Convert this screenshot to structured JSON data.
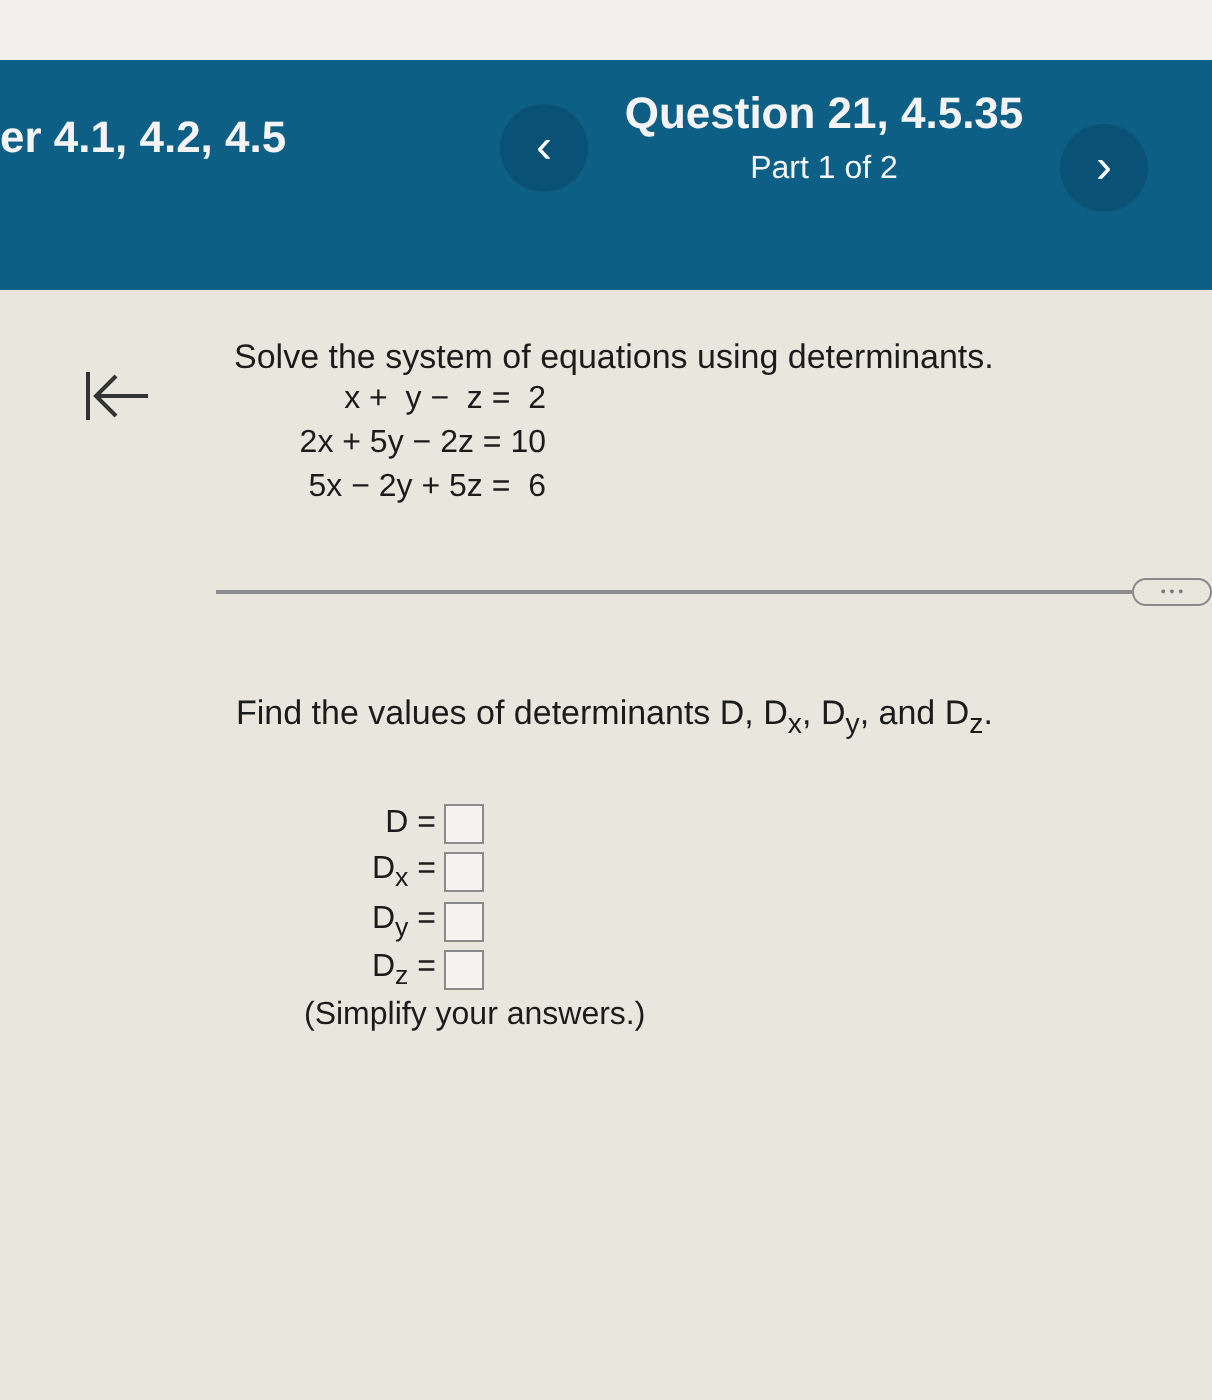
{
  "header": {
    "section_title": "er 4.1, 4.2, 4.5",
    "question_title": "Question 21, 4.5.35",
    "part": "Part 1 of 2",
    "prev_button": "‹",
    "next_button": "›"
  },
  "problem": {
    "instruction": "Solve the system of equations using determinants.",
    "equations": [
      "x +  y −  z =  2",
      "2x + 5y − 2z = 10",
      "5x − 2y + 5z =  6"
    ]
  },
  "more_button": "• • •",
  "question": "Find the values of determinants D, D$_{x}$, D$_{y}$, and D$_{z}$.",
  "answers": [
    {
      "label": "D ="
    },
    {
      "label": "D$_{x}$ ="
    },
    {
      "label": "D$_{y}$ ="
    },
    {
      "label": "D$_{z}$ ="
    }
  ],
  "note": "(Simplify your answers.)"
}
